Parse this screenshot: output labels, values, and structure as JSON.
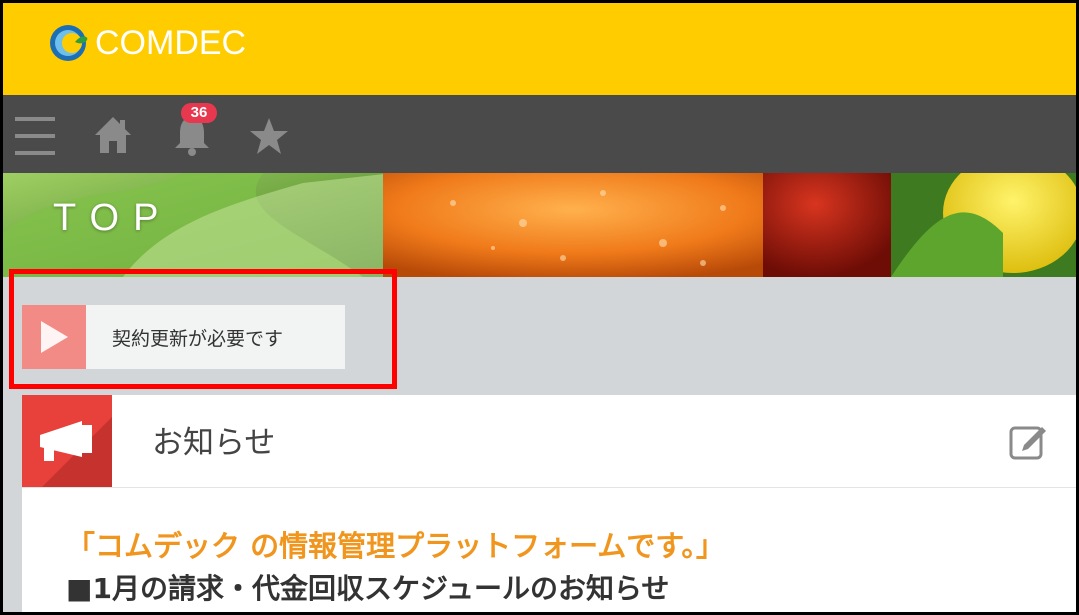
{
  "header": {
    "logo_text": "COMDEC",
    "background": "#ffcc00"
  },
  "nav": {
    "menu_icon": "hamburger-icon",
    "home_icon": "home-icon",
    "notification_icon": "bell-icon",
    "notification_count": "36",
    "favorite_icon": "star-icon",
    "background": "#4a4a4a"
  },
  "banner": {
    "title": "TOP"
  },
  "alert": {
    "label": "契約更新が必要です",
    "icon": "play-icon",
    "highlight_color": "#ff0000"
  },
  "notice_panel": {
    "title": "お知らせ",
    "icon": "megaphone-icon",
    "edit_icon": "edit-icon",
    "headline": "「コムデック の情報管理プラットフォームです。」",
    "subheading": "■1月の請求・代金回収スケジュールのお知らせ",
    "accent": "#e8413c",
    "headline_color": "#f0961e"
  }
}
